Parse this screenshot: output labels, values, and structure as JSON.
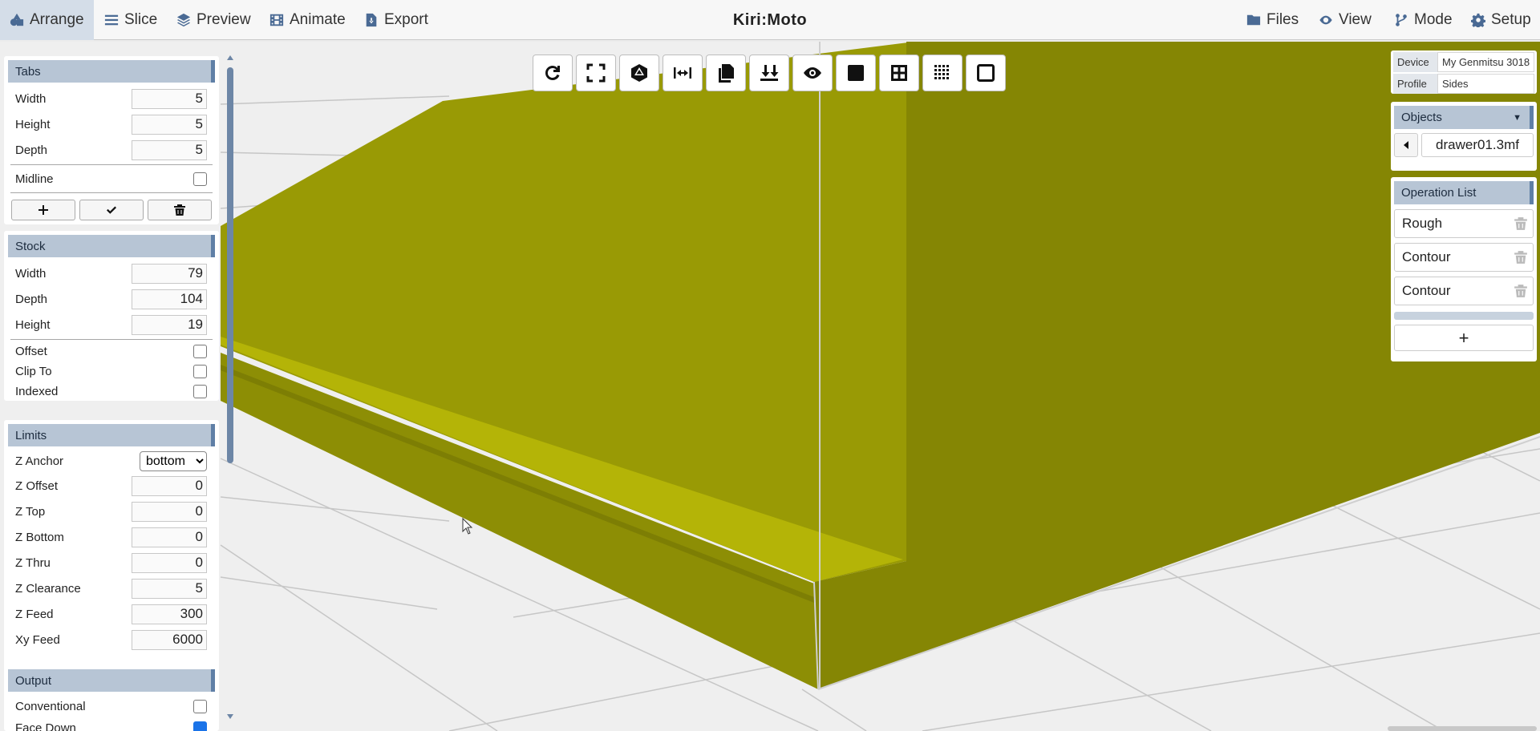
{
  "app": {
    "title": "Kiri:Moto"
  },
  "menu_left": [
    {
      "label": "Arrange",
      "icon": "shapes-icon"
    },
    {
      "label": "Slice",
      "icon": "list-icon"
    },
    {
      "label": "Preview",
      "icon": "layers-icon"
    },
    {
      "label": "Animate",
      "icon": "film-icon"
    },
    {
      "label": "Export",
      "icon": "file-export-icon"
    }
  ],
  "menu_right": [
    {
      "label": "Files",
      "icon": "folder-icon"
    },
    {
      "label": "View",
      "icon": "eye-icon"
    },
    {
      "label": "Mode",
      "icon": "code-branch-icon"
    },
    {
      "label": "Setup",
      "icon": "gear-icon"
    }
  ],
  "toolbar": [
    "rotate-icon",
    "expand-icon",
    "dice-icon",
    "arrows-h-icon",
    "copy-icon",
    "arrows-down-icon",
    "eye-icon",
    "square-solid-icon",
    "grid-icon",
    "dots-grid-icon",
    "square-outline-icon"
  ],
  "tabs": {
    "title": "Tabs",
    "width_label": "Width",
    "width": "5",
    "height_label": "Height",
    "height": "5",
    "depth_label": "Depth",
    "depth": "5",
    "midline_label": "Midline"
  },
  "stock": {
    "title": "Stock",
    "width_label": "Width",
    "width": "79",
    "depth_label": "Depth",
    "depth": "104",
    "height_label": "Height",
    "height": "19",
    "offset_label": "Offset",
    "clip_label": "Clip To",
    "indexed_label": "Indexed"
  },
  "limits": {
    "title": "Limits",
    "zanchor_label": "Z Anchor",
    "zanchor": "bottom",
    "zoffset_label": "Z Offset",
    "zoffset": "0",
    "ztop_label": "Z Top",
    "ztop": "0",
    "zbottom_label": "Z Bottom",
    "zbottom": "0",
    "zthru_label": "Z Thru",
    "zthru": "0",
    "zclearance_label": "Z Clearance",
    "zclearance": "5",
    "zfeed_label": "Z Feed",
    "zfeed": "300",
    "xyfeed_label": "Xy Feed",
    "xyfeed": "6000"
  },
  "output": {
    "title": "Output",
    "conventional_label": "Conventional",
    "facedown_label": "Face Down"
  },
  "device": {
    "device_label": "Device",
    "device_value": "My Genmitsu 3018",
    "profile_label": "Profile",
    "profile_value": "Sides"
  },
  "objects": {
    "title": "Objects",
    "caret": "▼",
    "file": "drawer01.3mf"
  },
  "operations": {
    "title": "Operation List",
    "items": [
      {
        "label": "Rough"
      },
      {
        "label": "Contour"
      },
      {
        "label": "Contour"
      }
    ],
    "add_label": "+"
  },
  "colors": {
    "model_top": "#b4b407",
    "model_main": "#999a05",
    "model_side": "#858604",
    "accent": "#5f7fa6"
  }
}
